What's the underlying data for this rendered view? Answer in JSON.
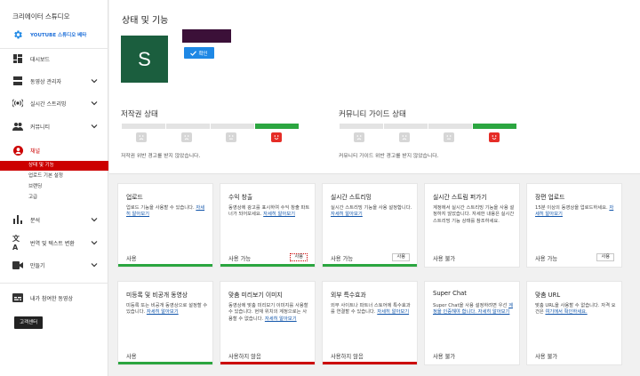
{
  "sidebar": {
    "title": "크리에이터 스튜디오",
    "brand_label": "YOUTUBE 스튜디오 베타",
    "items": [
      {
        "label": "대시보드"
      },
      {
        "label": "동영상 관리자"
      },
      {
        "label": "실시간 스트리밍"
      },
      {
        "label": "커뮤니티"
      },
      {
        "label": "채널"
      },
      {
        "label": "분석"
      },
      {
        "label": "번역 및 텍스트 변환"
      },
      {
        "label": "만들기"
      },
      {
        "label": "내가 참여한 동영상"
      }
    ],
    "channel_subitems": [
      {
        "label": "상태 및 기능"
      },
      {
        "label": "업로드 기본 설정"
      },
      {
        "label": "브랜딩"
      },
      {
        "label": "고급"
      }
    ],
    "feedback_label": "고객센터"
  },
  "header": {
    "title": "상태 및 기능",
    "avatar_letter": "S",
    "verify_label": "확인"
  },
  "copyright": {
    "heading": "저작권 상태",
    "text": "저작권 위반 경고를 받지 않았습니다."
  },
  "community": {
    "heading": "커뮤니티 가이드 상태",
    "text": "커뮤니티 가이드 위반 경고를 받지 않았습니다."
  },
  "cards": [
    {
      "title": "업로드",
      "desc": "업로드 기능을 사용할 수 있습니다. ",
      "link": "자세히 알아보기",
      "status": "사용",
      "bar": "#2ba640",
      "button": ""
    },
    {
      "title": "수익 창출",
      "desc": "동영상에 광고를 표시하여 수익 창출 파트너가 되어보세요. ",
      "link": "자세히 알아보기",
      "status": "사용 가능",
      "bar": "#2ba640",
      "button": "사용"
    },
    {
      "title": "실시간 스트리밍",
      "desc": "실시간 스트리밍 기능을 사용 설정합니다. ",
      "link": "자세히 알아보기",
      "status": "사용 가능",
      "bar": "#2ba640",
      "button": "사용"
    },
    {
      "title": "실시간 스트림 퍼가기",
      "desc": "계정에서 실시간 스트리밍 기능을 사용 설정하지 않았습니다. 자세한 내용은 실시간 스트리밍 기능 상태를 참조하세요.",
      "link": "",
      "status": "사용 불가",
      "bar": "",
      "button": ""
    },
    {
      "title": "장편 업로드",
      "desc": "15분 이상의 동영상을 업로드하세요. ",
      "link": "자세히 알아보기",
      "status": "사용 가능",
      "bar": "",
      "button": "사용"
    },
    {
      "title": "미등록 및 비공개 동영상",
      "desc": "미등록 또는 비공개 동영상으로 설정할 수 있습니다. ",
      "link": "자세히 알아보기",
      "status": "사용",
      "bar": "#2ba640",
      "button": ""
    },
    {
      "title": "맞춤 미리보기 이미지",
      "desc": "동영상에 맞춤 미리보기 이미지를 사용할 수 있습니다. 현재 위치의 계정으로는 사용할 수 없습니다. ",
      "link": "자세히 알아보기",
      "status": "사용하지 않음",
      "bar": "#cc0000",
      "button": ""
    },
    {
      "title": "외부 특수효과",
      "desc": "외부 사이트나 파트너 스토어에 특수효과를 연결할 수 있습니다. ",
      "link": "자세히 알아보기",
      "status": "사용하지 않음",
      "bar": "#cc0000",
      "button": ""
    },
    {
      "title": "Super Chat",
      "desc": "Super Chat을 사용 설정하려면 우선 ",
      "link": "계정을 인증해야 합니다. 자세히 알아보기",
      "status": "사용 불가",
      "bar": "",
      "button": ""
    },
    {
      "title": "맞춤 URL",
      "desc": "맞춤 URL을 사용할 수 없습니다. 자격 요건은 ",
      "link": "여기에서 확인하세요.",
      "status": "사용 불가",
      "bar": "",
      "button": ""
    }
  ],
  "colors": {
    "accent_red": "#cc0000",
    "green": "#2ba640",
    "blue": "#1e88e5"
  }
}
